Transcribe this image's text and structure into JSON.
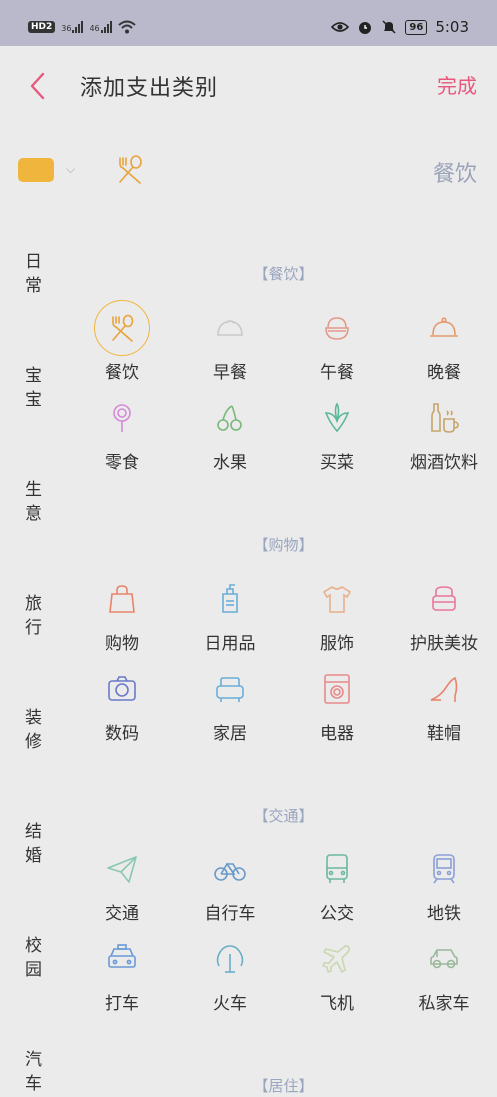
{
  "status_bar": {
    "left": [
      "HD2",
      "36",
      "46"
    ],
    "battery": "96",
    "time": "5:03"
  },
  "header": {
    "title": "添加支出类别",
    "done": "完成"
  },
  "picker": {
    "swatch_color": "#f0b53c",
    "selected_name": "餐饮"
  },
  "sidebar": [
    "日常",
    "宝宝",
    "生意",
    "旅行",
    "装修",
    "结婚",
    "校园",
    "汽车"
  ],
  "sections": [
    {
      "title": "【餐饮】",
      "items": [
        {
          "label": "餐饮",
          "icon": "fork-spoon-icon",
          "color": "#e8a33c",
          "selected": true
        },
        {
          "label": "早餐",
          "icon": "bun-icon",
          "color": "#c9c9c9"
        },
        {
          "label": "午餐",
          "icon": "bowl-icon",
          "color": "#e49a8a"
        },
        {
          "label": "晚餐",
          "icon": "cloche-icon",
          "color": "#e49a6a"
        },
        {
          "label": "零食",
          "icon": "lollipop-icon",
          "color": "#d48ad8"
        },
        {
          "label": "水果",
          "icon": "cherry-icon",
          "color": "#7ab87a"
        },
        {
          "label": "买菜",
          "icon": "vegetable-icon",
          "color": "#5ab89a"
        },
        {
          "label": "烟酒饮料",
          "icon": "bottle-cup-icon",
          "color": "#c7a56a"
        }
      ]
    },
    {
      "title": "【购物】",
      "items": [
        {
          "label": "购物",
          "icon": "shopping-bag-icon",
          "color": "#e8846a"
        },
        {
          "label": "日用品",
          "icon": "lotion-bottle-icon",
          "color": "#6aaed8"
        },
        {
          "label": "服饰",
          "icon": "tshirt-icon",
          "color": "#e8b08a"
        },
        {
          "label": "护肤美妆",
          "icon": "cosmetics-icon",
          "color": "#e8779a"
        },
        {
          "label": "数码",
          "icon": "camera-icon",
          "color": "#6a7ac8"
        },
        {
          "label": "家居",
          "icon": "sofa-icon",
          "color": "#6aaed8"
        },
        {
          "label": "电器",
          "icon": "washing-machine-icon",
          "color": "#e88a8a"
        },
        {
          "label": "鞋帽",
          "icon": "high-heel-icon",
          "color": "#e8846a"
        }
      ]
    },
    {
      "title": "【交通】",
      "items": [
        {
          "label": "交通",
          "icon": "paper-plane-icon",
          "color": "#8ac8b0"
        },
        {
          "label": "自行车",
          "icon": "bicycle-icon",
          "color": "#6a9ac8"
        },
        {
          "label": "公交",
          "icon": "bus-icon",
          "color": "#6ab8a0"
        },
        {
          "label": "地铁",
          "icon": "metro-icon",
          "color": "#8aa0d8"
        },
        {
          "label": "打车",
          "icon": "taxi-icon",
          "color": "#6a9ad8"
        },
        {
          "label": "火车",
          "icon": "train-icon",
          "color": "#6aaec8"
        },
        {
          "label": "飞机",
          "icon": "airplane-icon",
          "color": "#c8d8b0"
        },
        {
          "label": "私家车",
          "icon": "car-icon",
          "color": "#9ab89a"
        }
      ]
    },
    {
      "title": "【居住】",
      "items": []
    }
  ]
}
